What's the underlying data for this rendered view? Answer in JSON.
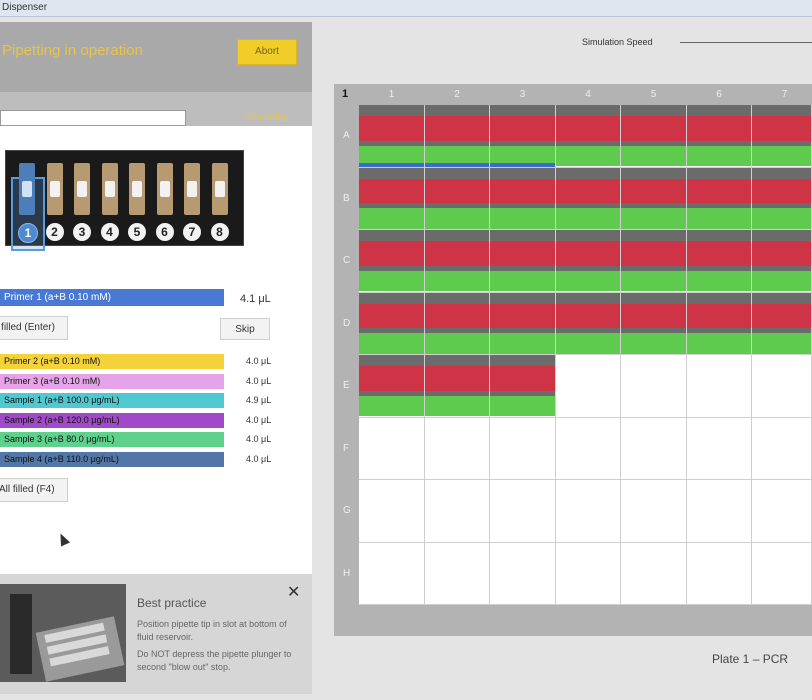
{
  "window": {
    "title": "Dispenser"
  },
  "header": {
    "title": "Pipetting in operation",
    "abort_label": "Abort",
    "status": "Simulating"
  },
  "pipette": {
    "channels": [
      "1",
      "2",
      "3",
      "4",
      "5",
      "6",
      "7",
      "8"
    ],
    "selected": 1
  },
  "current_row": {
    "label": "Primer 1 (a+B  0.10 mM)",
    "volume": "4.1 μL",
    "color": "#4a79d4"
  },
  "buttons": {
    "filled_label": "Well filled  (Enter)",
    "skip_label": "Skip",
    "all_filled_label": "All filled  (F4)"
  },
  "reagents": [
    {
      "label": "Primer 2 (a+B  0.10 mM)",
      "volume": "4.0 μL",
      "color": "#f4d33a"
    },
    {
      "label": "Primer 3 (a+B  0.10 mM)",
      "volume": "4.0 μL",
      "color": "#e6a4e8"
    },
    {
      "label": "Sample 1 (a+B  100.0 μg/mL)",
      "volume": "4.9 μL",
      "color": "#4fc8cf"
    },
    {
      "label": "Sample 2 (a+B  120.0 μg/mL)",
      "volume": "4.0 μL",
      "color": "#a04ac8"
    },
    {
      "label": "Sample 3 (a+B  80.0 μg/mL)",
      "volume": "4.0 μL",
      "color": "#5fd18d"
    },
    {
      "label": "Sample 4 (a+B  110.0 μg/mL)",
      "volume": "4.0 μL",
      "color": "#5277a6"
    }
  ],
  "best_practice": {
    "title": "Best practice",
    "line1": "Position pipette tip in slot at bottom of fluid reservoir.",
    "line2": "Do NOT depress the pipette plunger to second \"blow out\" stop.",
    "close_icon": "close-icon"
  },
  "simulation": {
    "label": "Simulation Speed"
  },
  "plate": {
    "title": "Plate 1 – PCR",
    "corner": "1",
    "columns": [
      "1",
      "2",
      "3",
      "4",
      "5",
      "6",
      "7"
    ],
    "rows": [
      "A",
      "B",
      "C",
      "D",
      "E",
      "F",
      "G",
      "H"
    ],
    "filled_rows": [
      "A",
      "B",
      "C",
      "D"
    ],
    "partial_row": {
      "row": "E",
      "columns": 3
    },
    "colors": {
      "top": "#6b6b6b",
      "red": "#cf3346",
      "green": "#5fcb4e",
      "blue": "#3b6bd1",
      "yellow": "#c7d43a"
    }
  }
}
